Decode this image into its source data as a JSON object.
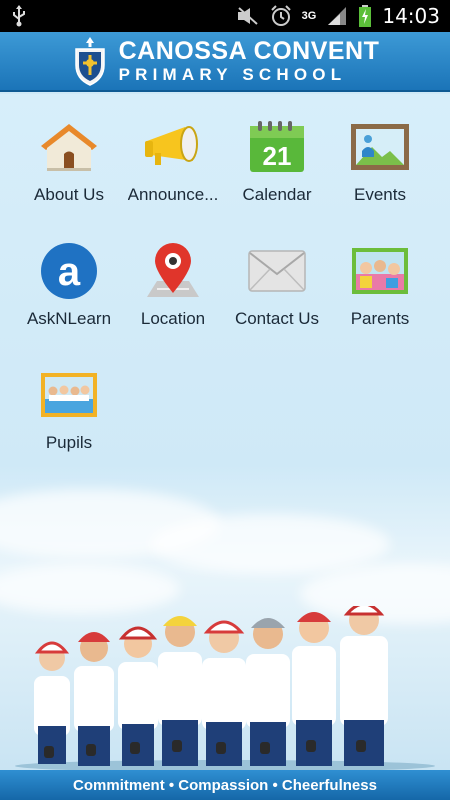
{
  "status_bar": {
    "time": "14:03",
    "network": "3G",
    "icons": [
      "usb-icon",
      "muted-icon",
      "alarm-icon",
      "signal-icon",
      "battery-charging-icon"
    ]
  },
  "header": {
    "title_line1": "CANOSSA CONVENT",
    "title_line2": "PRIMARY SCHOOL",
    "logo": "school-crest-icon",
    "background": "#2a86c8"
  },
  "menu": {
    "items": [
      {
        "label": "About Us",
        "icon": "house-icon"
      },
      {
        "label": "Announce...",
        "icon": "megaphone-icon"
      },
      {
        "label": "Calendar",
        "icon": "calendar-icon",
        "calendar_day": "21"
      },
      {
        "label": "Events",
        "icon": "picture-frame-icon"
      },
      {
        "label": "AskNLearn",
        "icon": "asknlearn-icon",
        "icon_letter": "a"
      },
      {
        "label": "Location",
        "icon": "map-pin-icon"
      },
      {
        "label": "Contact Us",
        "icon": "envelope-icon"
      },
      {
        "label": "Parents",
        "icon": "parents-photo-icon"
      },
      {
        "label": "Pupils",
        "icon": "pupils-photo-icon"
      }
    ]
  },
  "footer": {
    "motto": "Commitment • Compassion • Cheerfulness"
  },
  "colors": {
    "accent": "#1b74b8",
    "background": "#cfe9f7",
    "label_text": "#1b2a38"
  }
}
